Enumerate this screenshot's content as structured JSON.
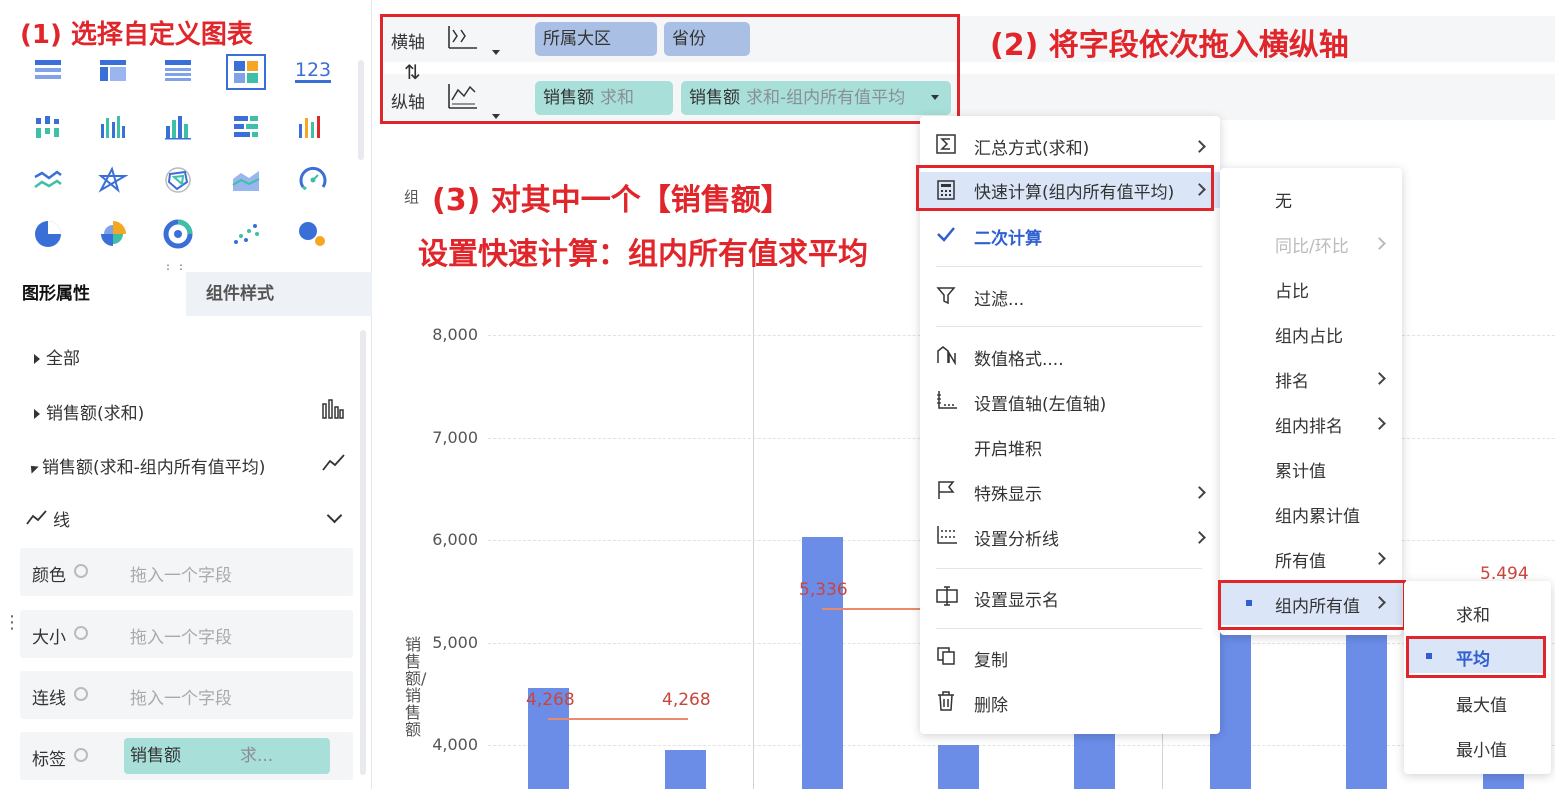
{
  "annotations": {
    "step1": "(1) 选择自定义图表",
    "step2": "(2) 将字段依次拖入横纵轴",
    "step3_line1": "(3) 对其中一个【销售额】",
    "step3_line2": "设置快速计算：组内所有值求平均"
  },
  "chart_types": {
    "icons": [
      "table-icon",
      "cross-table-icon",
      "detail-table-icon",
      "custom-chart-icon",
      "kpi-icon",
      "grouped-bar-icon",
      "bar-icon",
      "column-icon",
      "horizontal-bar-icon",
      "multi-column-icon",
      "line-icon",
      "star-icon",
      "radar-icon",
      "area-icon",
      "gauge-icon",
      "pie-icon",
      "rose-icon",
      "ring-icon",
      "scatter-icon",
      "bubble-icon"
    ],
    "kpi_label": "123"
  },
  "left_tabs": {
    "active": "图形属性",
    "inactive": "组件样式"
  },
  "tree": {
    "all": "全部",
    "measure1": "销售额(求和)",
    "measure2": "销售额(求和-组内所有值平均)",
    "line_section": "线"
  },
  "props": [
    {
      "label": "颜色",
      "placeholder": "拖入一个字段"
    },
    {
      "label": "大小",
      "placeholder": "拖入一个字段"
    },
    {
      "label": "连线",
      "placeholder": "拖入一个字段"
    },
    {
      "label": "标签",
      "field": "销售额",
      "field_sub": "求..."
    }
  ],
  "axes": {
    "x_label": "横轴",
    "y_label": "纵轴",
    "swap": "⇅",
    "x_fields": [
      "所属大区",
      "省份"
    ],
    "y_fields": [
      {
        "name": "销售额",
        "agg": "求和"
      },
      {
        "name": "销售额",
        "agg": "求和-组内所有值平均"
      }
    ]
  },
  "chart_data": {
    "type": "bar",
    "ylabel": "销售额/销售额",
    "legend_stub": "组",
    "yticks": [
      "8,000",
      "7,000",
      "6,000",
      "5,000",
      "4,000"
    ],
    "ylim": [
      3600,
      8400
    ],
    "bars": [
      {
        "value": 4560
      },
      {
        "value": 3950
      },
      {
        "value": 6030
      },
      {
        "value": 4000
      },
      {
        "value": 5300
      },
      {
        "value": 6400
      },
      {
        "value": 5900
      },
      {
        "value": 5100
      }
    ],
    "avg_labels": [
      {
        "value": 4268,
        "text": "4,268"
      },
      {
        "value": 4268,
        "text": "4,268"
      },
      {
        "value": 5336,
        "text": "5,336"
      },
      {
        "value": 5494,
        "text": "5.494"
      }
    ]
  },
  "context_menu": {
    "items": [
      {
        "icon": "sum-icon",
        "label": "汇总方式(求和)",
        "arrow": true
      },
      {
        "icon": "calculator-icon",
        "label": "快速计算(组内所有值平均)",
        "arrow": true
      },
      {
        "icon": "check-icon",
        "label": "二次计算",
        "arrow": false
      },
      {
        "icon": "filter-icon",
        "label": "过滤...",
        "arrow": false
      },
      {
        "icon": "number-format-icon",
        "label": "数值格式....",
        "arrow": false
      },
      {
        "icon": "value-axis-icon",
        "label": "设置值轴(左值轴)",
        "arrow": false
      },
      {
        "icon": "",
        "label": "开启堆积",
        "arrow": false
      },
      {
        "icon": "flag-icon",
        "label": "特殊显示",
        "arrow": true
      },
      {
        "icon": "analysis-line-icon",
        "label": "设置分析线",
        "arrow": true
      },
      {
        "icon": "rename-icon",
        "label": "设置显示名",
        "arrow": false
      },
      {
        "icon": "copy-icon",
        "label": "复制",
        "arrow": false
      },
      {
        "icon": "trash-icon",
        "label": "删除",
        "arrow": false
      }
    ]
  },
  "quick_calc_menu": {
    "items": [
      {
        "label": "无",
        "arrow": false,
        "disabled": false
      },
      {
        "label": "同比/环比",
        "arrow": true,
        "disabled": true
      },
      {
        "label": "占比",
        "arrow": false,
        "disabled": false
      },
      {
        "label": "组内占比",
        "arrow": false,
        "disabled": false
      },
      {
        "label": "排名",
        "arrow": true,
        "disabled": false
      },
      {
        "label": "组内排名",
        "arrow": true,
        "disabled": false
      },
      {
        "label": "累计值",
        "arrow": false,
        "disabled": false
      },
      {
        "label": "组内累计值",
        "arrow": false,
        "disabled": false
      },
      {
        "label": "所有值",
        "arrow": true,
        "disabled": false
      },
      {
        "label": "组内所有值",
        "arrow": true,
        "disabled": false,
        "selected": true
      }
    ]
  },
  "agg_menu": {
    "items": [
      "求和",
      "平均",
      "最大值",
      "最小值"
    ],
    "selected": "平均"
  },
  "colors": {
    "accent_red": "#e0262b",
    "bar_blue": "#6b8de8",
    "selected_bg": "#dbe5f8",
    "selected_text": "#2f5fd0"
  }
}
